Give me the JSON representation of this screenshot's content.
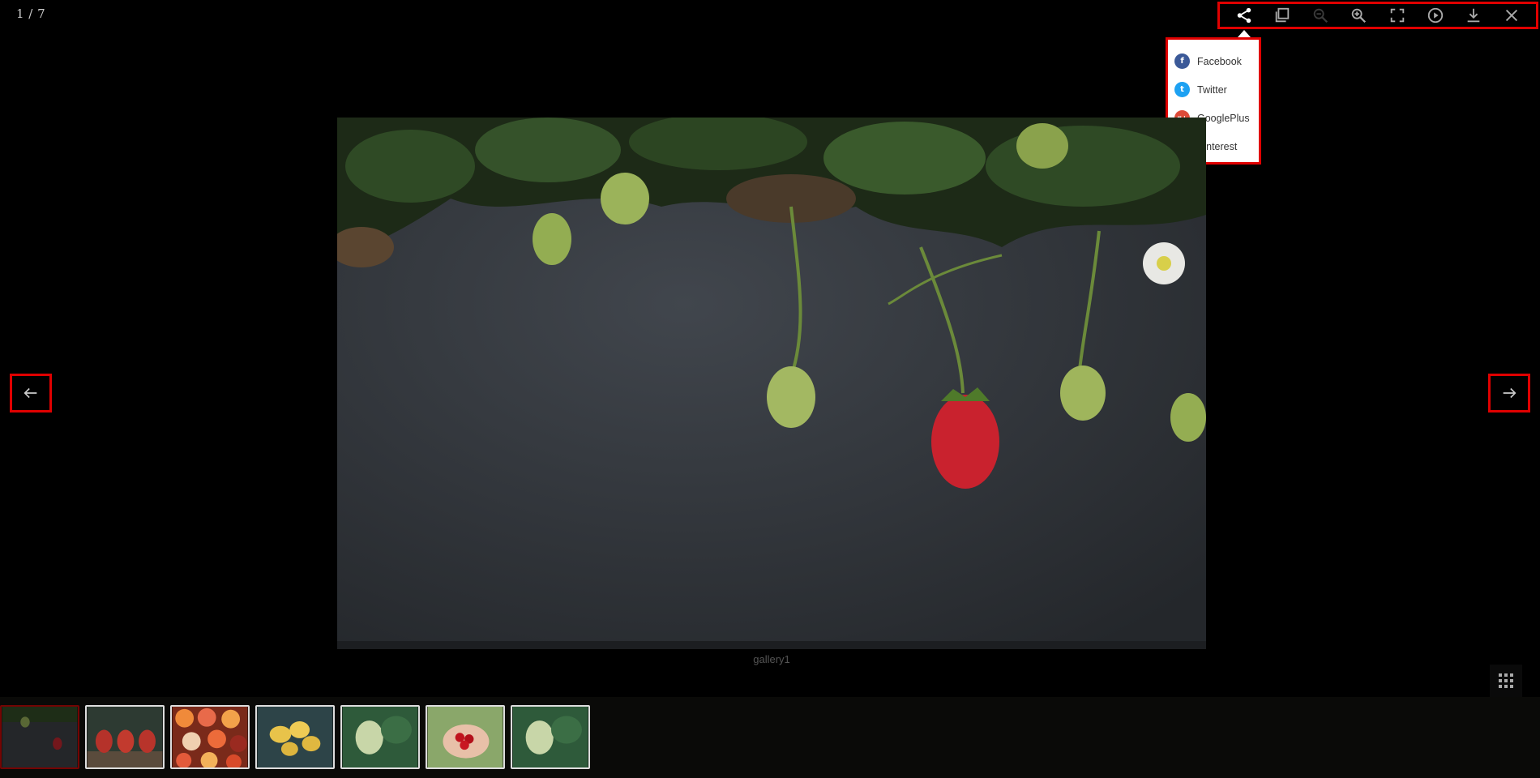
{
  "counter": "1 / 7",
  "toolbar": {
    "buttons": [
      {
        "name": "share-icon",
        "enabled": true
      },
      {
        "name": "copy-icon",
        "enabled": true
      },
      {
        "name": "zoom-out-icon",
        "enabled": false
      },
      {
        "name": "zoom-in-icon",
        "enabled": true
      },
      {
        "name": "fullscreen-icon",
        "enabled": true
      },
      {
        "name": "play-icon",
        "enabled": true
      },
      {
        "name": "download-icon",
        "enabled": true
      },
      {
        "name": "close-icon",
        "enabled": true
      }
    ]
  },
  "share_menu": {
    "items": [
      {
        "label": "Facebook",
        "glyph": "f",
        "color": "#3b5998"
      },
      {
        "label": "Twitter",
        "glyph": "t",
        "color": "#1da1f2"
      },
      {
        "label": "GooglePlus",
        "glyph": "g+",
        "color": "#dd4b39"
      },
      {
        "label": "Pinterest",
        "glyph": "p",
        "color": "#cb2027"
      }
    ]
  },
  "image": {
    "caption": "gallery1"
  },
  "nav": {
    "prev_icon": "arrow-left-icon",
    "next_icon": "arrow-right-icon"
  },
  "grid_icon": "grid-icon",
  "thumbnails": [
    {
      "subject": "strawberry",
      "active": true
    },
    {
      "subject": "pears",
      "active": false
    },
    {
      "subject": "citrus",
      "active": false
    },
    {
      "subject": "lemons",
      "active": false
    },
    {
      "subject": "grapes",
      "active": false
    },
    {
      "subject": "cherries",
      "active": false
    },
    {
      "subject": "grapes",
      "active": false
    }
  ],
  "colors": {
    "accent": "#e00000",
    "background": "#000000"
  }
}
